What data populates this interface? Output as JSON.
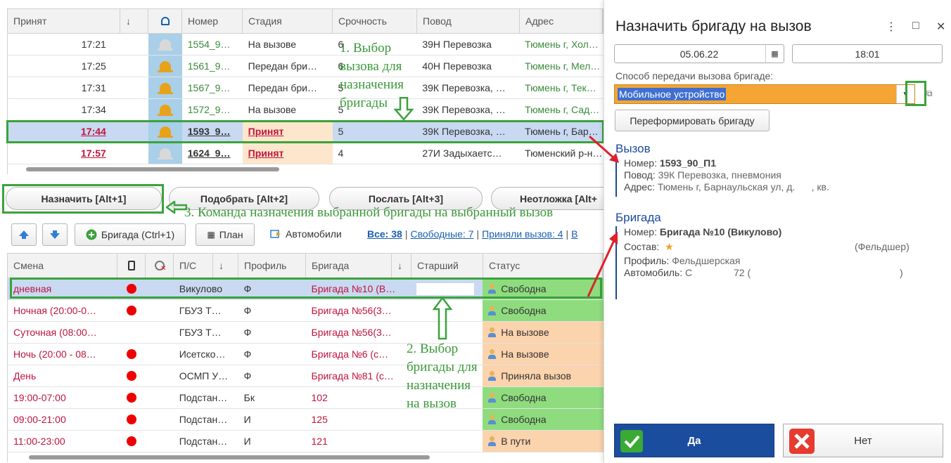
{
  "calls_table": {
    "headers": [
      "Принят",
      "↓",
      "",
      "Номер",
      "Стадия",
      "Срочность",
      "Повод",
      "Адрес"
    ],
    "rows": [
      {
        "time": "17:21",
        "bell": "grey",
        "number": "1554_9…",
        "stage": "На вызове",
        "urgency": "6",
        "reason": "39Н Перевозка",
        "address": "Тюмень г, Хол…"
      },
      {
        "time": "17:25",
        "bell": "orange",
        "number": "1561_9…",
        "stage": "Передан бри…",
        "urgency": "6",
        "reason": "40Н Перевозка",
        "address": "Тюмень г, Мел…"
      },
      {
        "time": "17:31",
        "bell": "orange",
        "number": "1567_9…",
        "stage": "Передан бри…",
        "urgency": "5",
        "reason": "39К Перевозка, …",
        "address": "Тюмень г, Тек…"
      },
      {
        "time": "17:34",
        "bell": "orange",
        "number": "1572_9…",
        "stage": "На вызове",
        "urgency": "5",
        "reason": "39К Перевозка, …",
        "address": "Тюмень г, Сад…"
      },
      {
        "time": "17:44",
        "bell": "orange",
        "number": "1593_9…",
        "stage": "Принят",
        "urgency": "5",
        "reason": "39К Перевозка, …",
        "address": "Тюмень г, Бар…"
      },
      {
        "time": "17:57",
        "bell": "grey",
        "number": "1624_9…",
        "stage": "Принят",
        "urgency": "4",
        "reason": "27И Задыхаетс…",
        "address": "Тюменский р-н…"
      }
    ]
  },
  "commands": {
    "assign": "Назначить [Alt+1]",
    "pick": "Подобрать [Alt+2]",
    "send": "Послать [Alt+3]",
    "emergency": "Неотложка [Alt+"
  },
  "toolbar": {
    "crew_button": "Бригада (Ctrl+1)",
    "plan_button": "План",
    "cars_button": "Автомобили",
    "filter_all": "Все: 38",
    "filter_free": "Свободные: 7",
    "filter_accepted": "Приняли вызов: 4",
    "filter_more": "В"
  },
  "crews_table": {
    "headers": [
      "Смена",
      "",
      "",
      "П/С",
      "↓",
      "Профиль",
      "Бригада",
      "↓",
      "Старший",
      "Статус"
    ],
    "rows": [
      {
        "shift": "дневная",
        "dot": true,
        "ps": "Викулово",
        "profile": "Ф",
        "brigade": "Бригада №10 (В…",
        "senior": "",
        "status": "Свободна",
        "status_kind": "free"
      },
      {
        "shift": "Ночная (20:00-0…",
        "dot": true,
        "ps": "ГБУЗ Т…",
        "profile": "Ф",
        "brigade": "Бригада №56(3…",
        "senior": "",
        "status": "Свободна",
        "status_kind": "free"
      },
      {
        "shift": "Суточная (08:00…",
        "dot": false,
        "ps": "ГБУЗ Т…",
        "profile": "Ф",
        "brigade": "Бригада №56(3…",
        "senior": "",
        "status": "На вызове",
        "status_kind": "busy"
      },
      {
        "shift": "Ночь (20:00 - 08…",
        "dot": true,
        "ps": "Исетско…",
        "profile": "Ф",
        "brigade": "Бригада №6 (с…",
        "senior": "",
        "status": "На вызове",
        "status_kind": "busy"
      },
      {
        "shift": "День",
        "dot": true,
        "ps": "ОСМП У…",
        "profile": "Ф",
        "brigade": "Бригада №81 (с…",
        "senior": "",
        "status": "Приняла вызов",
        "status_kind": "busy"
      },
      {
        "shift": "19:00-07:00",
        "dot": true,
        "ps": "Подстан…",
        "profile": "Бк",
        "brigade": "102",
        "senior": "",
        "status": "Свободна",
        "status_kind": "free"
      },
      {
        "shift": "09:00-21:00",
        "dot": true,
        "ps": "Подстан…",
        "profile": "И",
        "brigade": "125",
        "senior": "",
        "status": "Свободна",
        "status_kind": "free"
      },
      {
        "shift": "11:00-23:00",
        "dot": true,
        "ps": "Подстан…",
        "profile": "И",
        "brigade": "121",
        "senior": "",
        "status": "В пути",
        "status_kind": "busy"
      }
    ]
  },
  "dialog": {
    "title": "Назначить бригаду на вызов",
    "date": "05.06.22",
    "time": "18:01",
    "transfer_label": "Способ передачи вызова бригаде:",
    "transfer_value": "Мобильное устройство",
    "reform_button": "Переформировать бригаду",
    "call_section": {
      "title": "Вызов",
      "number_label": "Номер:",
      "number_value": "1593_90_П1",
      "reason_label": "Повод:",
      "reason_value": "39К Перевозка, пневмония",
      "address_label": "Адрес:",
      "address_value": "Тюмень г, Барнаульская ул, д.      , кв."
    },
    "brigade_section": {
      "title": "Бригада",
      "number_label": "Номер:",
      "number_value": "Бригада №10 (Викулово)",
      "staff_label": "Состав:",
      "staff_value": "(Фельдшер)",
      "profile_label": "Профиль:",
      "profile_value": "Фельдшерская",
      "car_label": "Автомобиль:",
      "car_value": "С",
      "car_value_2": "72 (",
      "car_value_3": ")"
    },
    "yes_button": "Да",
    "no_button": "Нет"
  },
  "annotations": {
    "step1": "1. Выбор вызова для назначения бригады",
    "step2": "2. Выбор бригады для назначения на вызов",
    "step3": "3. Команда назначения выбранной бригады на выбранный вызов"
  }
}
